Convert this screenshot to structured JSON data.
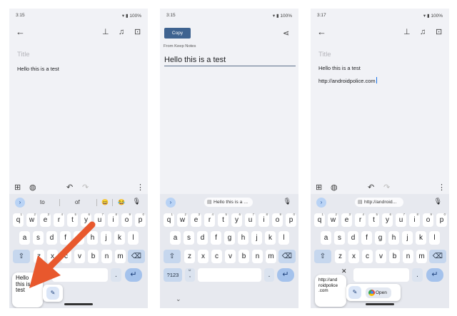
{
  "panel1": {
    "status": {
      "time": "3:15",
      "battery": "100%"
    },
    "title_placeholder": "Title",
    "note_line1": "Hello this is a test",
    "suggestions": [
      "to",
      "of"
    ],
    "clip_text": "Hello\nthis is a\ntest",
    "emoji": [
      "😄",
      "😂"
    ]
  },
  "panel2": {
    "status": {
      "time": "3:15",
      "battery": "100%"
    },
    "copy_label": "Copy",
    "from_label": "From Keep Notes",
    "share_text": "Hello this is a test",
    "chip_text": "Hello this is a ...",
    "symbols_label": "?123"
  },
  "panel3": {
    "status": {
      "time": "3:17",
      "battery": "100%"
    },
    "title_placeholder": "Title",
    "note_line1": "Hello this is a test",
    "note_line2": "http://androidpolice.com",
    "chip_text": "http://android...",
    "clip_text": "http://and\nroidpolice\n.com",
    "open_label": "Open"
  },
  "keyboard": {
    "row1": [
      "q",
      "w",
      "e",
      "r",
      "t",
      "y",
      "u",
      "i",
      "o",
      "p"
    ],
    "row1_hints": [
      "1",
      "2",
      "3",
      "4",
      "5",
      "6",
      "7",
      "8",
      "9",
      "0"
    ],
    "row2": [
      "a",
      "s",
      "d",
      "f",
      "g",
      "h",
      "j",
      "k",
      "l"
    ],
    "row3": [
      "z",
      "x",
      "c",
      "v",
      "b",
      "n",
      "m"
    ],
    "dot": ".",
    "comma": ","
  },
  "colors": {
    "accent": "#1a73e8",
    "function_key": "#c6d7ee",
    "enter_key": "#a4c2ec",
    "arrow": "#e8582d",
    "copy_button": "#3f6390"
  }
}
